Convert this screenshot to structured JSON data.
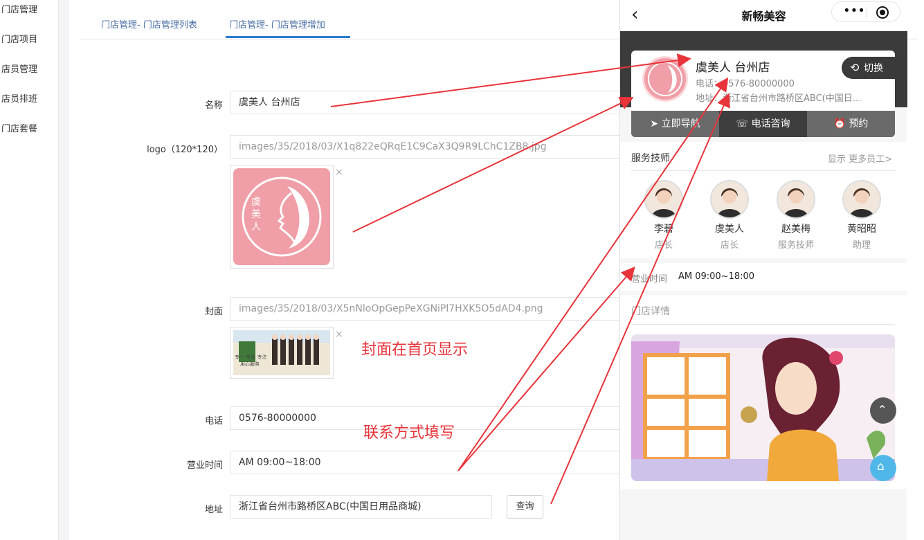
{
  "sidebar": {
    "items": [
      {
        "label": "门店管理"
      },
      {
        "label": "门店项目"
      },
      {
        "label": "店员管理"
      },
      {
        "label": "店员排班"
      },
      {
        "label": "门店套餐"
      }
    ]
  },
  "tabs": [
    {
      "label": "门店管理- 门店管理列表"
    },
    {
      "label": "门店管理- 门店管理增加"
    }
  ],
  "form": {
    "name_label": "名称",
    "name_value": "虞美人 台州店",
    "logo_label": "logo（120*120）",
    "logo_value": "images/35/2018/03/X1q822eQRqE1C9CaX3Q9R9LChC1ZB8.jpg",
    "logo_text": "虞美人",
    "cover_label": "封面",
    "cover_value": "images/35/2018/03/X5nNloOpGepPeXGNiPl7HXK5O5dAD4.png",
    "cover_text_1": "专一  专业  专注",
    "cover_text_2": "用心服务",
    "phone_label": "电话",
    "phone_value": "0576-80000000",
    "hours_label": "营业时间",
    "hours_value": "AM 09:00~18:00",
    "address_label": "地址",
    "address_value": "浙江省台州市路桥区ABC(中国日用品商城)",
    "query_button": "查询",
    "remove_glyph": "×"
  },
  "annotations": {
    "cover_note": "封面在首页显示",
    "contact_note": "联系方式填写"
  },
  "phone": {
    "nav_title": "新畅美容",
    "back_glyph": "‹",
    "more_glyph": "•••",
    "store_name": "虞美人 台州店",
    "store_phone": "电话：0576-80000000",
    "store_address": "地址：浙江省台州市路桥区ABC(中国日…",
    "switch_label": "切换",
    "actions": [
      {
        "label": "立即导航",
        "icon": "navigation-icon"
      },
      {
        "label": "电话咨询",
        "icon": "phone-icon"
      },
      {
        "label": "预约",
        "icon": "alarm-clock-icon"
      }
    ],
    "staff_title": "服务技师",
    "staff_more": "显示 更多员工>",
    "staff": [
      {
        "name": "李碧",
        "role": "店长"
      },
      {
        "name": "虞美人",
        "role": "店长"
      },
      {
        "name": "赵美梅",
        "role": "服务技师"
      },
      {
        "name": "黄昭昭",
        "role": "助理"
      }
    ],
    "hours_label": "营业时间",
    "hours_value": "AM 09:00~18:00",
    "details_title": "门店详情"
  },
  "colors": {
    "accent": "#2d7dd2",
    "tab_text": "#4a6fa5",
    "annotation_red": "#e8333a",
    "logo_pink": "#f09ea7",
    "dark_band": "#3b3b3b"
  }
}
